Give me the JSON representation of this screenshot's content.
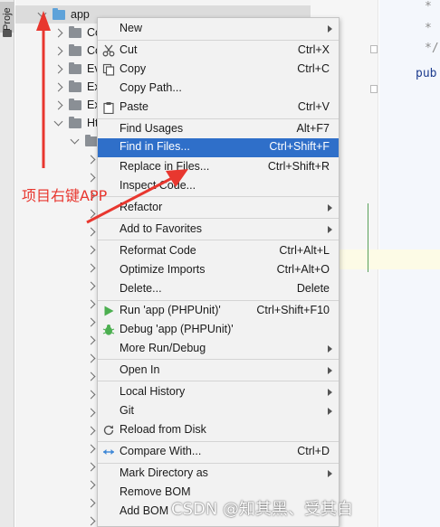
{
  "sidebar": {
    "tab_label": "Proje"
  },
  "tree": {
    "root": "app",
    "children": [
      "Co",
      "Co",
      "Ev",
      "Ex",
      "Ex",
      "Ht"
    ]
  },
  "editor": {
    "lines": [
      "*",
      "*",
      "*/",
      "pub"
    ]
  },
  "menu": {
    "items": [
      {
        "label": "New",
        "shortcut": "",
        "submenu": true,
        "icon": ""
      },
      {
        "label": "Cut",
        "shortcut": "Ctrl+X",
        "submenu": false,
        "icon": "scissors-icon"
      },
      {
        "label": "Copy",
        "shortcut": "Ctrl+C",
        "submenu": false,
        "icon": "copy-icon"
      },
      {
        "label": "Copy Path...",
        "shortcut": "",
        "submenu": false,
        "icon": ""
      },
      {
        "label": "Paste",
        "shortcut": "Ctrl+V",
        "submenu": false,
        "icon": "clipboard-icon"
      },
      {
        "label": "Find Usages",
        "shortcut": "Alt+F7",
        "submenu": false,
        "icon": ""
      },
      {
        "label": "Find in Files...",
        "shortcut": "Ctrl+Shift+F",
        "submenu": false,
        "icon": ""
      },
      {
        "label": "Replace in Files...",
        "shortcut": "Ctrl+Shift+R",
        "submenu": false,
        "icon": ""
      },
      {
        "label": "Inspect Code...",
        "shortcut": "",
        "submenu": false,
        "icon": ""
      },
      {
        "label": "Refactor",
        "shortcut": "",
        "submenu": true,
        "icon": ""
      },
      {
        "label": "Add to Favorites",
        "shortcut": "",
        "submenu": true,
        "icon": ""
      },
      {
        "label": "Reformat Code",
        "shortcut": "Ctrl+Alt+L",
        "submenu": false,
        "icon": ""
      },
      {
        "label": "Optimize Imports",
        "shortcut": "Ctrl+Alt+O",
        "submenu": false,
        "icon": ""
      },
      {
        "label": "Delete...",
        "shortcut": "Delete",
        "submenu": false,
        "icon": ""
      },
      {
        "label": "Run 'app (PHPUnit)'",
        "shortcut": "Ctrl+Shift+F10",
        "submenu": false,
        "icon": "run-icon"
      },
      {
        "label": "Debug 'app (PHPUnit)'",
        "shortcut": "",
        "submenu": false,
        "icon": "debug-icon"
      },
      {
        "label": "More Run/Debug",
        "shortcut": "",
        "submenu": true,
        "icon": ""
      },
      {
        "label": "Open In",
        "shortcut": "",
        "submenu": true,
        "icon": ""
      },
      {
        "label": "Local History",
        "shortcut": "",
        "submenu": true,
        "icon": ""
      },
      {
        "label": "Git",
        "shortcut": "",
        "submenu": true,
        "icon": ""
      },
      {
        "label": "Reload from Disk",
        "shortcut": "",
        "submenu": false,
        "icon": "reload-icon"
      },
      {
        "label": "Compare With...",
        "shortcut": "Ctrl+D",
        "submenu": false,
        "icon": "compare-icon"
      },
      {
        "label": "Mark Directory as",
        "shortcut": "",
        "submenu": true,
        "icon": ""
      },
      {
        "label": "Remove BOM",
        "shortcut": "",
        "submenu": false,
        "icon": ""
      },
      {
        "label": "Add BOM",
        "shortcut": "",
        "submenu": false,
        "icon": ""
      }
    ],
    "highlighted": "Find in Files..."
  },
  "annotation": {
    "text": "项目右键APP",
    "color": "#e8372f"
  },
  "watermark": {
    "text": "CSDN @知其黑、受其白"
  },
  "colors": {
    "highlight": "#2f6fc9",
    "folder_blue": "#5ea2d9",
    "run_green": "#4caf50",
    "arrow_red": "#e8372f"
  }
}
